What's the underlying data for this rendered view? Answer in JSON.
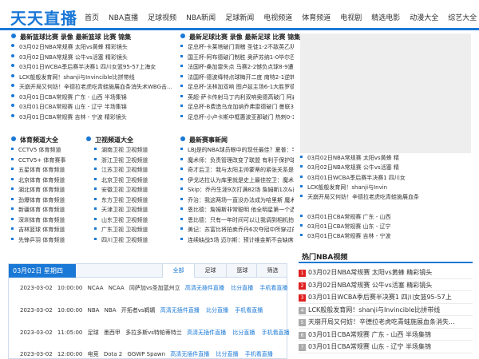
{
  "site": {
    "logo": "天天直播"
  },
  "nav": [
    "首页",
    "NBA直播",
    "足球视频",
    "NBA新闻",
    "足球新闻",
    "电视频道",
    "体育频道",
    "电视剧",
    "精选电影",
    "动漫大全",
    "综艺大全"
  ],
  "basketball": {
    "title": "最新篮球比赛 录像  最新篮球 比赛 锦集",
    "items": [
      "03月02日NBA常规赛 太阳vs黄蜂 精彩镜头",
      "03月02日NBA常规赛 公牛vs活塞 精彩镜头",
      "03月01日WCBA季后赛半决赛1 四川女篮95-57上海女",
      "LCK般般发育网！shanji与Invincible比拼带线",
      "天崩开局又何妨！辛德拉老虎吃青蛙施展血条消失术WBG击...",
      "03月01日CBA常规赛 广东 - 山西 半场集锦",
      "03月01日CBA常规赛 山东 - 辽宁 半场集锦",
      "03月01日CBA常规赛 吉林 - 宁波 精彩镜头"
    ]
  },
  "football": {
    "title": "最新足球比赛 录像  最新足球 比赛 锦集",
    "items": [
      "足总杯-卡莱塔破门滑稽 圣徒1-2不敌英乙队",
      "国王杯-阿布德破门制胜 奥萨苏纳1-0毕尔巴鄂",
      "法国杯-桑加雷失点 马赛2-2憾负点球8-9遭淘汰",
      "法国杯-德波绛特点球梅开二度 南特2-1逆转朗斯",
      "足总杯-法林加双响 图卢兹主场6-1大胜罗德兹",
      "英超-萨卡传射马丁内利双响奥德高破门 阿森纳4-0埃弗顿5分",
      "足总杯-B费造乌龙加纳乔弗雷德破门 曼联3-1逆转西汉姆进8",
      "足总杯-小卢卡斯中框惠波亚那破门 热刺0-1谢菲联遭淘汰"
    ]
  },
  "sports_channels": {
    "title": "体育频道大全",
    "items": [
      "CCTV5 体育频道",
      "CCTV5+ 体育赛事",
      "五星体育 体育频道",
      "北京体育 体育频道",
      "湖北体育 体育频道",
      "劲爆体育 体育频道",
      "新疆体育 体育频道",
      "深圳体育 体育频道",
      "吉林篮球 体育频道",
      "先锋乒羽 体育频道"
    ]
  },
  "tv_channels": {
    "title": "卫视频道大全",
    "items": [
      "湖南卫视 卫视频道",
      "浙江卫视 卫视频道",
      "江苏卫视 卫视频道",
      "北京卫视 卫视频道",
      "安徽卫视 卫视频道",
      "东方卫视 卫视频道",
      "天津卫视 卫视频道",
      "山东卫视 卫视频道",
      "广东卫视 卫视频道",
      "四川卫视 卫视频道"
    ]
  },
  "news": {
    "title": "最新赛事新闻",
    "items": [
      "LBJ是的NBA球员眼中的现任最佳？夏普：字母哥和约基奇要强",
      "魔术师：负责管理改变了联盟 有利于保护球员但损害了比赛",
      "奇才后卫：我与太阳主帅蒙蒂的紧张关系是申请交易的主要原因",
      "伊戈达拉认为库里就是史上最佳控卫：魔术师身边有着更好...",
      "Skip：乔丹生涯9次打满82场 詹姆斯1次&戴维斯0次",
      "乔治：我这两场一直没办法成为哈里斯 魔术师对此并不满意",
      "恩比德：詹姆斯非常聪明 他全明星第一个选我证明一些懂得...",
      "恩比德：只有一年时间可以让我调到相机拍下！努力赢下总冠军",
      "美记：苏富比将拍卖乔丹6次夺冠中所穿过的六双球鞋 张可能...",
      "连续缺战5场 迈尔斯：预计维金斯不会缺席很长一段时间"
    ]
  },
  "right_list": [
    "03月02日NBA常规赛 太阳vs黄蜂 精",
    "03月02日NBA常规赛 公牛vs活塞 精",
    "03月01日WCBA季后赛半决赛1 四川女",
    "LCK般般发育网！shanji与Invin",
    "天崩开局又何妨！辛德拉老虎吃青蛙施展血条",
    "03月01日CBA常规赛 广东 - 山西",
    "03月01日CBA常规赛 山东 - 辽宁",
    "03月01日CBA常规赛 吉林 - 宁波"
  ],
  "hot": {
    "title": "热门NBA视频",
    "items": [
      "03月02日NBA常规赛 太阳vs黄蜂 精彩镜头",
      "03月02日NBA常规赛 公牛vs活塞 精彩镜头",
      "03月01日WCBA季后赛半决赛1 四川女篮95-57上",
      "LCK般般发育网！shanji与Invincible比拼带线",
      "天崩开局又何妨！辛德拉老虎吃青蛙施展血条消失...",
      "03月01日CBA常规赛 广东 - 山西 半场集锦",
      "03月01日CBA常规赛 山东 - 辽宁 半场集锦"
    ],
    "numbers": [
      "1",
      "2",
      "3",
      "4",
      "5",
      "6",
      "7"
    ]
  },
  "schedule": {
    "date": "03月02日 星期四",
    "filters": [
      "全部",
      "足球",
      "篮球",
      "筛选"
    ],
    "rows": [
      {
        "date": "2023-03-02",
        "time": "10:00:00",
        "league": "NCAA",
        "l2": "NCAA",
        "match": "冈萨加vs圣加蓝州立",
        "links": [
          "高清无插件直播",
          "比分直播",
          "手机看直播"
        ]
      },
      {
        "date": "2023-03-02",
        "time": "10:00:00",
        "league": "NBA",
        "l2": "NBA",
        "match": "开拓者vs鹈鹕",
        "links": [
          "高清无插件直播",
          "比分直播",
          "手机看直播"
        ]
      },
      {
        "date": "2023-03-02",
        "time": "11:05:00",
        "league": "足球",
        "l2": "墨西甲",
        "match": "多拉多斯vs特帕蒂特兰",
        "links": [
          "高清无插件直播",
          "比分直播",
          "手机看直播"
        ]
      },
      {
        "date": "2023-03-02",
        "time": "12:00:00",
        "league": "电竞",
        "l2": "Dota 2",
        "match": "GGWP Spawn",
        "links": [
          "高清无插件直播",
          "比分直播",
          "手机看直播"
        ]
      }
    ]
  }
}
